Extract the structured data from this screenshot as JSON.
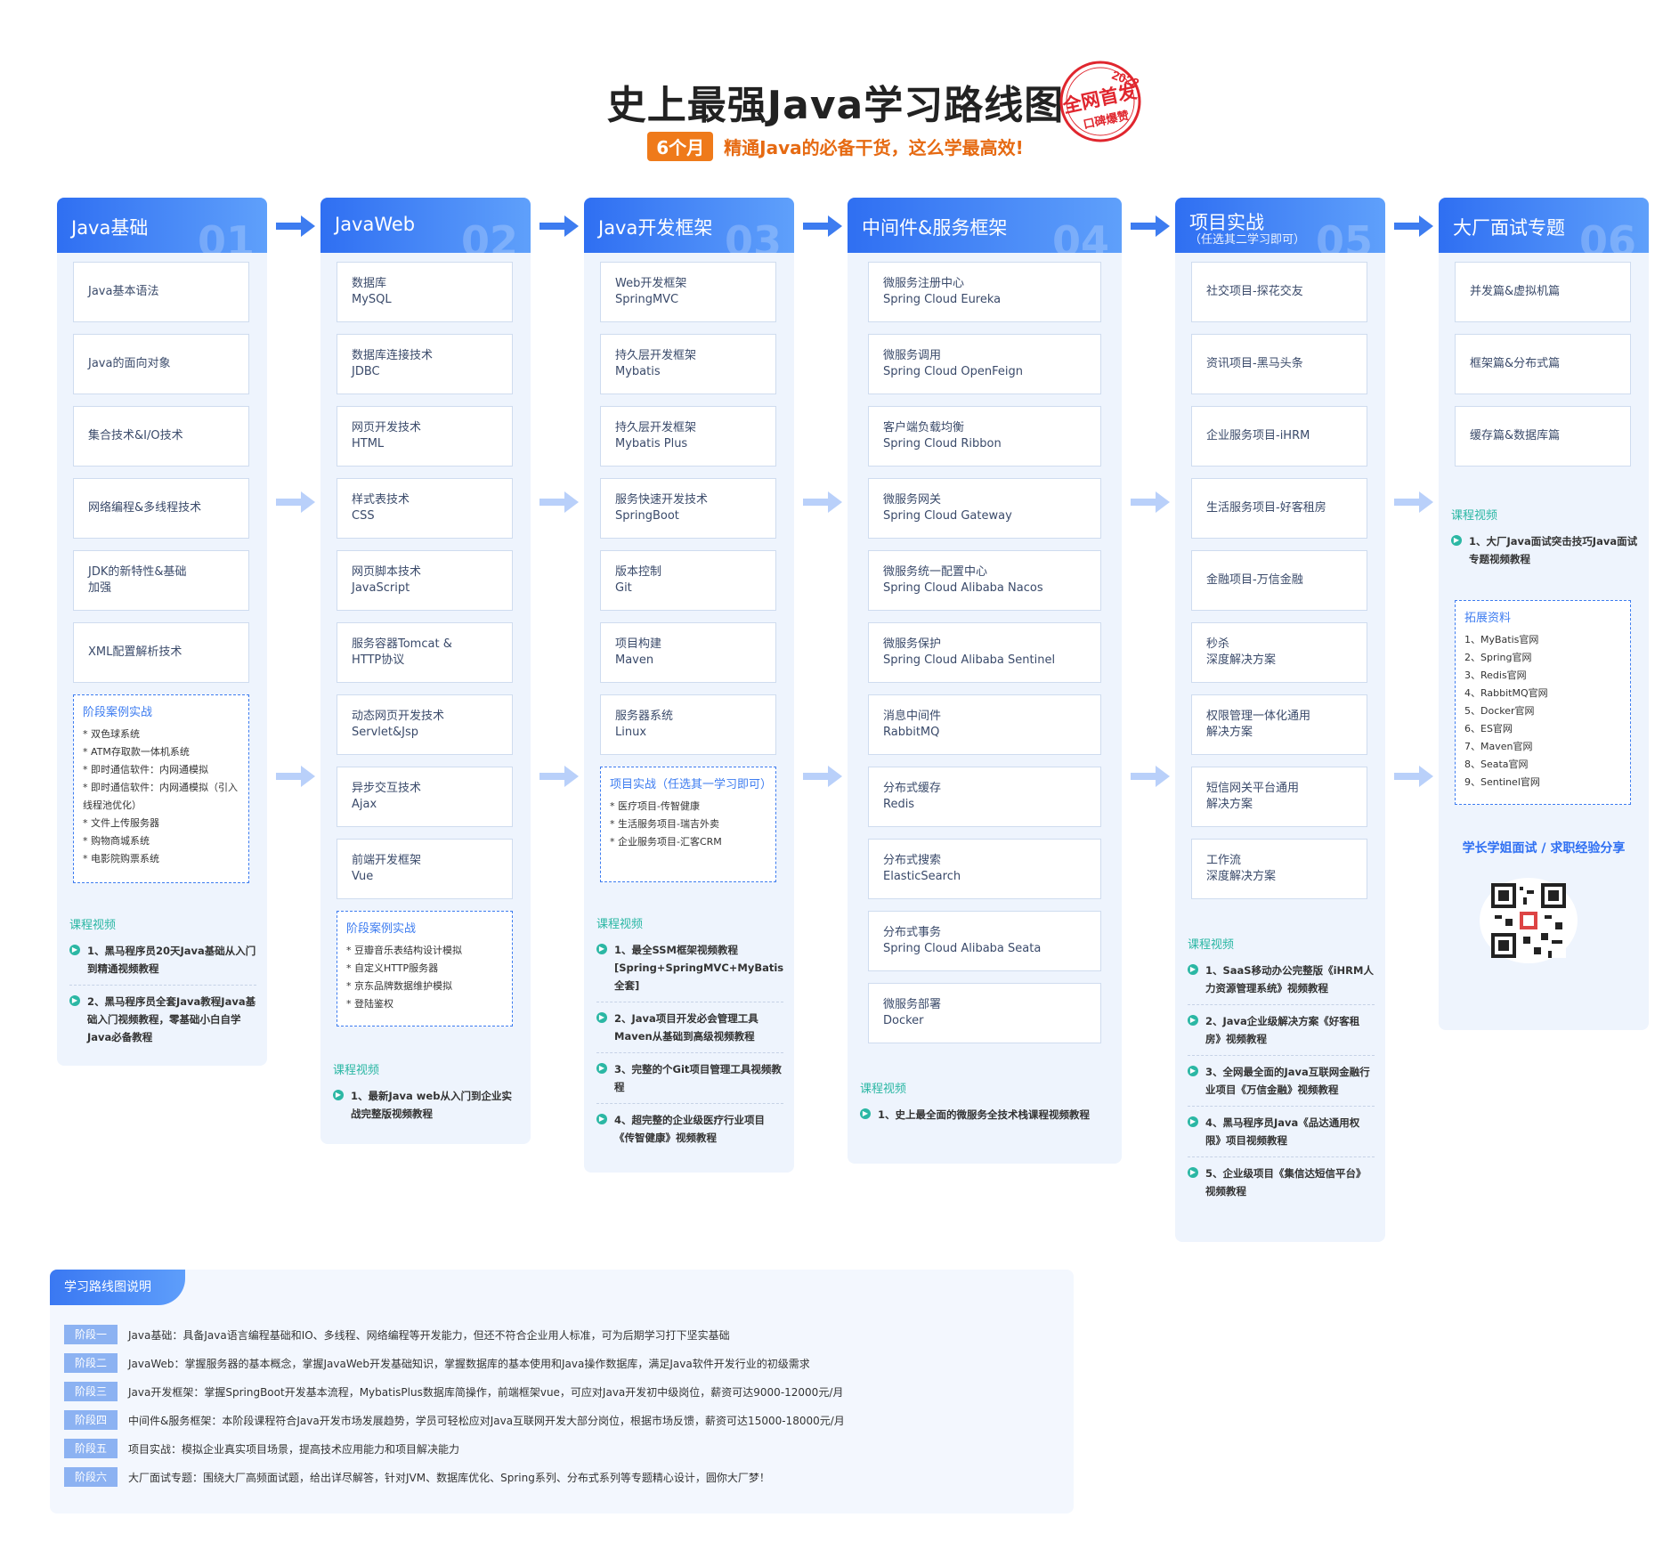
{
  "header": {
    "title": "史上最强Java学习路线图",
    "stamp_top": "2022",
    "stamp_main": "全网首发",
    "stamp_sub": "口碑爆赞",
    "badge": "6个月",
    "subtitle": "精通Java的必备干货，这么学最高效!"
  },
  "columns": [
    {
      "title": "Java基础",
      "num": "01",
      "items": [
        [
          "Java基本语法"
        ],
        [
          "Java的面向对象"
        ],
        [
          "集合技术&I/O技术"
        ],
        [
          "网络编程&多线程技术"
        ],
        [
          "JDK的新特性&基础",
          "加强"
        ],
        [
          "XML配置解析技术"
        ]
      ],
      "case_title": "阶段案例实战",
      "cases": [
        "双色球系统",
        "ATM存取款一体机系统",
        "即时通信软件：内网通模拟",
        "即时通信软件：内网通模拟（引入线程池优化）",
        "文件上传服务器",
        "购物商城系统",
        "电影院购票系统"
      ],
      "video_title": "课程视频",
      "videos": [
        "1、黑马程序员20天Java基础从入门到精通视频教程",
        "2、黑马程序员全套Java教程Java基础入门视频教程，零基础小白自学Java必备教程"
      ]
    },
    {
      "title": "JavaWeb",
      "num": "02",
      "items": [
        [
          "数据库",
          "MySQL"
        ],
        [
          "数据库连接技术",
          "JDBC"
        ],
        [
          "网页开发技术",
          "HTML"
        ],
        [
          "样式表技术",
          "CSS"
        ],
        [
          "网页脚本技术",
          "JavaScript"
        ],
        [
          "服务容器Tomcat &",
          "HTTP协议"
        ],
        [
          "动态网页开发技术",
          "Servlet&Jsp"
        ],
        [
          "异步交互技术",
          "Ajax"
        ],
        [
          "前端开发框架",
          "Vue"
        ]
      ],
      "case_title": "阶段案例实战",
      "cases": [
        "豆瓣音乐表结构设计模拟",
        "自定义HTTP服务器",
        "京东品牌数据维护模拟",
        "登陆鉴权"
      ],
      "video_title": "课程视频",
      "videos": [
        "1、最新Java web从入门到企业实战完整版视频教程"
      ]
    },
    {
      "title": "Java开发框架",
      "num": "03",
      "items": [
        [
          "Web开发框架",
          "SpringMVC"
        ],
        [
          "持久层开发框架",
          "Mybatis"
        ],
        [
          "持久层开发框架",
          "Mybatis Plus"
        ],
        [
          "服务快速开发技术",
          "SpringBoot"
        ],
        [
          "版本控制",
          "Git"
        ],
        [
          "项目构建",
          "Maven"
        ],
        [
          "服务器系统",
          "Linux"
        ]
      ],
      "case_title": "项目实战（任选其一学习即可）",
      "cases": [
        "医疗项目-传智健康",
        "生活服务项目-瑞吉外卖",
        "企业服务项目-汇客CRM"
      ],
      "video_title": "课程视频",
      "videos": [
        "1、最全SSM框架视频教程[Spring+SpringMVC+MyBatis全套]",
        "2、Java项目开发必会管理工具Maven从基础到高级视频教程",
        "3、完整的个Git项目管理工具视频教程",
        "4、超完整的企业级医疗行业项目《传智健康》视频教程"
      ]
    },
    {
      "title": "中间件&服务框架",
      "num": "04",
      "items": [
        [
          "微服务注册中心",
          "Spring Cloud Eureka"
        ],
        [
          "微服务调用",
          "Spring Cloud OpenFeign"
        ],
        [
          "客户端负载均衡",
          "Spring Cloud Ribbon"
        ],
        [
          "微服务网关",
          "Spring Cloud Gateway"
        ],
        [
          "微服务统一配置中心",
          "Spring Cloud Alibaba Nacos"
        ],
        [
          "微服务保护",
          "Spring Cloud Alibaba Sentinel"
        ],
        [
          "消息中间件",
          "RabbitMQ"
        ],
        [
          "分布式缓存",
          "Redis"
        ],
        [
          "分布式搜索",
          "ElasticSearch"
        ],
        [
          "分布式事务",
          "Spring Cloud Alibaba Seata"
        ],
        [
          "微服务部署",
          "Docker"
        ]
      ],
      "video_title": "课程视频",
      "videos": [
        "1、史上最全面的微服务全技术栈课程视频教程"
      ]
    },
    {
      "title": "项目实战",
      "subtitle": "（任选其二学习即可）",
      "num": "05",
      "items": [
        [
          "社交项目-探花交友"
        ],
        [
          "资讯项目-黑马头条"
        ],
        [
          "企业服务项目-iHRM"
        ],
        [
          "生活服务项目-好客租房"
        ],
        [
          "金融项目-万信金融"
        ],
        [
          "秒杀",
          "深度解决方案"
        ],
        [
          "权限管理一体化通用",
          "解决方案"
        ],
        [
          "短信网关平台通用",
          "解决方案"
        ],
        [
          "工作流",
          "深度解决方案"
        ]
      ],
      "video_title": "课程视频",
      "videos": [
        "1、SaaS移动办公完整版《iHRM人力资源管理系统》视频教程",
        "2、Java企业级解决方案《好客租房》视频教程",
        "3、全网最全面的Java互联网金融行业项目《万信金融》视频教程",
        "4、黑马程序员Java《品达通用权限》项目视频教程",
        "5、企业级项目《集信达短信平台》视频教程"
      ]
    },
    {
      "title": "大厂面试专题",
      "num": "06",
      "items": [
        [
          "并发篇&虚拟机篇"
        ],
        [
          "框架篇&分布式篇"
        ],
        [
          "缓存篇&数据库篇"
        ]
      ],
      "video_title": "课程视频",
      "videos": [
        "1、大厂Java面试突击技巧Java面试专题视频教程"
      ],
      "ext_title": "拓展资料",
      "ext": [
        "1、MyBatis官网",
        "2、Spring官网",
        "3、Redis官网",
        "4、RabbitMQ官网",
        "5、Docker官网",
        "6、ES官网",
        "7、Maven官网",
        "8、Seata官网",
        "9、Sentinel官网"
      ],
      "share": "学长学姐面试 / 求职经验分享"
    }
  ],
  "legend": {
    "title": "学习路线图说明",
    "rows": [
      {
        "tag": "阶段一",
        "text": "Java基础：具备Java语言编程基础和IO、多线程、网络编程等开发能力，但还不符合企业用人标准，可为后期学习打下坚实基础"
      },
      {
        "tag": "阶段二",
        "text": "JavaWeb：掌握服务器的基本概念，掌握JavaWeb开发基础知识，掌握数据库的基本使用和Java操作数据库，满足Java软件开发行业的初级需求"
      },
      {
        "tag": "阶段三",
        "text": "Java开发框架：掌握SpringBoot开发基本流程，MybatisPlus数据库简操作，前端框架vue，可应对Java开发初中级岗位，薪资可达9000-12000元/月"
      },
      {
        "tag": "阶段四",
        "text": "中间件&服务框架：本阶段课程符合Java开发市场发展趋势，学员可轻松应对Java互联网开发大部分岗位，根据市场反馈，薪资可达15000-18000元/月"
      },
      {
        "tag": "阶段五",
        "text": "项目实战：模拟企业真实项目场景，提高技术应用能力和项目解决能力"
      },
      {
        "tag": "阶段六",
        "text": "大厂面试专题：围绕大厂高频面试题，给出详尽解答，针对JVM、数据库优化、Spring系列、分布式系列等专题精心设计，圆你大厂梦！"
      }
    ]
  },
  "colors": {
    "accent": "#3d7cf0",
    "green": "#2bb7a4",
    "orange": "#ef7a1a",
    "stamp": "#e0262e"
  }
}
